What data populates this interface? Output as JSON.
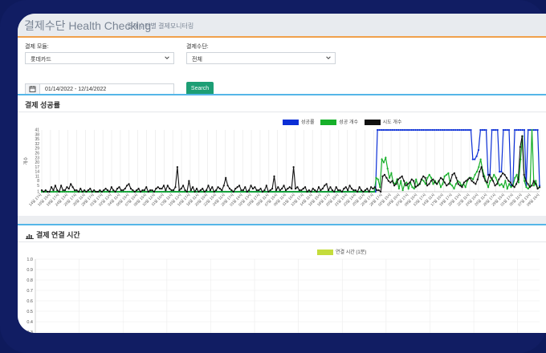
{
  "header": {
    "title": "결제수단 Health Checking",
    "subtitle": "결제수단별 결제모니터링"
  },
  "filters": {
    "group_label": "결제 모듈:",
    "group_value": "롯데카드",
    "method_label": "결제수단:",
    "method_value": "전체",
    "date_range": "01/14/2022 - 12/14/2022",
    "search_label": "Search"
  },
  "panel1": {
    "title": "결제 성공률",
    "chart_data": {
      "type": "line",
      "ylabel": "개수",
      "yticks": [
        1,
        5,
        8,
        11,
        14,
        17,
        20,
        23,
        26,
        29,
        32,
        35,
        38,
        41
      ],
      "ylim": [
        1,
        41
      ],
      "xticks": [
        "14일 17시",
        "16일 15시",
        "19일 17시",
        "24일 13시",
        "26일 17시",
        "28일 11시",
        "29일 17시",
        "01일 17시",
        "02일 12시",
        "04일 11시",
        "06일 15시",
        "07일 10시",
        "08일 15시",
        "10일 12시",
        "11일 10시",
        "13일 11시",
        "15일 12시",
        "16일 17시",
        "18일 11시",
        "20일 10시",
        "22일 15시",
        "24일 11시",
        "26일 17시",
        "01일 14시",
        "02일 13시",
        "03일 17시",
        "05일 11시",
        "07일 15시",
        "09일 11시",
        "11일 10시",
        "13일 17시",
        "14일 11시",
        "16일 15시",
        "18일 17시",
        "20일 10시",
        "21일 13시",
        "23일 14시",
        "25일 11시",
        "26일 17시",
        "28일 17시",
        "02일 15시",
        "04일 10시",
        "07일 17시",
        "09일 10시",
        "13일 17시",
        "14일 11시",
        "17일 10시",
        "19일 17시",
        "20일 13시",
        "22일 11시",
        "24일 10시",
        "26일 11시",
        "28일 17시",
        "29일 15시",
        "01일 17시",
        "05일 11시",
        "07일 13시",
        "09일 16시"
      ],
      "series": [
        {
          "name": "성공률",
          "color": "#0b2fd6",
          "values": [
            1,
            1,
            1,
            1,
            1,
            1,
            1,
            1,
            1,
            1,
            1,
            1,
            1,
            1,
            1,
            1,
            1,
            1,
            1,
            1,
            1,
            1,
            1,
            1,
            1,
            1,
            1,
            1,
            1,
            1,
            1,
            1,
            1,
            1,
            1,
            1,
            1,
            1,
            1,
            1,
            1,
            1,
            1,
            1,
            1,
            1,
            1,
            1,
            1,
            1,
            1,
            1,
            1,
            1,
            1,
            1,
            1,
            1,
            1,
            1,
            1,
            1,
            1,
            1,
            1,
            1,
            1,
            1,
            1,
            1,
            1,
            1,
            1,
            1,
            1,
            1,
            1,
            1,
            1,
            1,
            1,
            1,
            1,
            1,
            1,
            1,
            1,
            1,
            1,
            1,
            1,
            1,
            1,
            1,
            1,
            1,
            1,
            1,
            1,
            1,
            1,
            1,
            1,
            1,
            1,
            1,
            1,
            1,
            1,
            1,
            1,
            1,
            1,
            1,
            1,
            1,
            1,
            1,
            1,
            1,
            1,
            1,
            1,
            1,
            1,
            1,
            1,
            1,
            1,
            1,
            1,
            1,
            1,
            1,
            1,
            1,
            1,
            1,
            1,
            1,
            1,
            1,
            1,
            1,
            1,
            1,
            1,
            1,
            1,
            1,
            1,
            1,
            1,
            1,
            1,
            1,
            1,
            1,
            1,
            1,
            1,
            1,
            1,
            1,
            1,
            1,
            1,
            1,
            1,
            1,
            1,
            1,
            1,
            1,
            1,
            1,
            41,
            41,
            41,
            41,
            41,
            41,
            41,
            41,
            41,
            41,
            41,
            41,
            41,
            41,
            41,
            41,
            41,
            41,
            41,
            41,
            41,
            41,
            41,
            41,
            41,
            41,
            41,
            41,
            41,
            41,
            41,
            41,
            41,
            41,
            41,
            41,
            41,
            41,
            41,
            41,
            41,
            41,
            41,
            41,
            41,
            41,
            41,
            41,
            41,
            41,
            22,
            22,
            24,
            28,
            41,
            41,
            41,
            41,
            12,
            12,
            41,
            41,
            41,
            41,
            14,
            14,
            41,
            41,
            41,
            41,
            5,
            5,
            41,
            41,
            41,
            41,
            41,
            41,
            5,
            41,
            41,
            41,
            41,
            41,
            41,
            5
          ]
        },
        {
          "name": "성공 개수",
          "color": "#17b02a",
          "values": [
            1,
            1,
            1,
            1,
            1,
            1,
            1,
            1,
            1,
            1,
            1,
            1,
            1,
            1,
            1,
            1,
            1,
            1,
            1,
            1,
            1,
            1,
            1,
            1,
            1,
            1,
            1,
            1,
            1,
            1,
            1,
            1,
            1,
            1,
            1,
            1,
            1,
            1,
            1,
            1,
            1,
            1,
            1,
            1,
            1,
            1,
            1,
            1,
            1,
            1,
            1,
            1,
            1,
            1,
            1,
            1,
            1,
            1,
            1,
            1,
            1,
            1,
            1,
            1,
            1,
            1,
            1,
            1,
            1,
            1,
            1,
            1,
            1,
            1,
            1,
            1,
            1,
            1,
            1,
            1,
            1,
            1,
            1,
            1,
            1,
            1,
            1,
            1,
            1,
            1,
            1,
            1,
            1,
            1,
            1,
            1,
            1,
            1,
            1,
            1,
            1,
            1,
            1,
            1,
            1,
            1,
            1,
            1,
            1,
            1,
            1,
            1,
            1,
            1,
            1,
            1,
            1,
            1,
            1,
            1,
            1,
            1,
            1,
            1,
            1,
            1,
            1,
            1,
            1,
            1,
            1,
            1,
            1,
            1,
            1,
            1,
            1,
            1,
            1,
            1,
            1,
            1,
            1,
            1,
            1,
            1,
            1,
            1,
            1,
            1,
            1,
            1,
            1,
            1,
            1,
            1,
            1,
            1,
            1,
            1,
            1,
            1,
            1,
            1,
            1,
            1,
            1,
            1,
            1,
            1,
            1,
            1,
            1,
            1,
            1,
            1,
            10,
            9,
            4,
            22,
            20,
            23,
            16,
            10,
            13,
            7,
            6,
            9,
            3,
            8,
            2,
            6,
            7,
            3,
            7,
            4,
            3,
            9,
            5,
            6,
            9,
            8,
            6,
            10,
            12,
            10,
            6,
            8,
            6,
            8,
            4,
            6,
            11,
            12,
            13,
            6,
            5,
            3,
            6,
            8,
            7,
            5,
            6,
            4,
            8,
            10,
            10,
            9,
            12,
            14,
            17,
            22,
            15,
            11,
            7,
            4,
            8,
            9,
            12,
            10,
            7,
            5,
            6,
            4,
            8,
            3,
            6,
            4,
            5,
            10,
            12,
            7,
            22,
            37,
            8,
            4,
            3,
            5,
            41,
            5,
            8,
            3,
            4
          ]
        },
        {
          "name": "시도 개수",
          "color": "#111111",
          "values": [
            2,
            1,
            2,
            1,
            1,
            4,
            2,
            5,
            2,
            1,
            5,
            2,
            2,
            4,
            3,
            6,
            4,
            2,
            2,
            1,
            3,
            1,
            2,
            1,
            2,
            3,
            1,
            2,
            1,
            1,
            2,
            1,
            2,
            3,
            2,
            1,
            4,
            2,
            1,
            3,
            4,
            2,
            2,
            3,
            5,
            6,
            3,
            2,
            1,
            2,
            3,
            1,
            2,
            2,
            4,
            1,
            2,
            2,
            1,
            3,
            4,
            3,
            3,
            5,
            2,
            5,
            3,
            2,
            2,
            4,
            17,
            2,
            3,
            5,
            2,
            1,
            8,
            2,
            4,
            1,
            3,
            1,
            2,
            3,
            1,
            2,
            5,
            2,
            4,
            1,
            2,
            4,
            3,
            2,
            5,
            10,
            5,
            3,
            2,
            1,
            3,
            4,
            5,
            2,
            2,
            4,
            1,
            2,
            5,
            3,
            4,
            2,
            2,
            3,
            1,
            2,
            5,
            1,
            2,
            3,
            11,
            2,
            4,
            2,
            3,
            5,
            2,
            3,
            4,
            3,
            17,
            3,
            4,
            2,
            2,
            3,
            4,
            1,
            2,
            1,
            3,
            2,
            1,
            4,
            2,
            3,
            5,
            6,
            2,
            4,
            2,
            1,
            4,
            2,
            2,
            1,
            3,
            4,
            2,
            5,
            3,
            2,
            2,
            1,
            4,
            2,
            1,
            2,
            3,
            1,
            4,
            3,
            4,
            2,
            2,
            1,
            11,
            12,
            10,
            8,
            7,
            8,
            5,
            6,
            9,
            10,
            11,
            8,
            5,
            6,
            7,
            9,
            8,
            4,
            5,
            6,
            9,
            11,
            10,
            5,
            6,
            8,
            9,
            7,
            6,
            8,
            10,
            9,
            7,
            5,
            6,
            8,
            12,
            13,
            10,
            6,
            5,
            4,
            7,
            8,
            9,
            10,
            8,
            7,
            6,
            9,
            14,
            17,
            11,
            8,
            7,
            12,
            10,
            8,
            5,
            6,
            9,
            11,
            13,
            12,
            10,
            8,
            7,
            5,
            4,
            6,
            9,
            30,
            37,
            12,
            8,
            6,
            4,
            5,
            8,
            6,
            3,
            4
          ]
        }
      ]
    }
  },
  "panel2": {
    "title": "결제 연결 시간",
    "chart_data": {
      "type": "line",
      "yticks": [
        "0.3",
        "0.4",
        "0.5",
        "0.6",
        "0.7",
        "0.8",
        "0.9",
        "1.0"
      ],
      "series": [
        {
          "name": "연결 시간 (1분)",
          "color": "#c4dc3c",
          "values": []
        }
      ]
    }
  },
  "icons": {
    "calendar": "calendar-icon",
    "chart": "bar-chart-icon",
    "dropdown": "chevron-down-icon"
  }
}
